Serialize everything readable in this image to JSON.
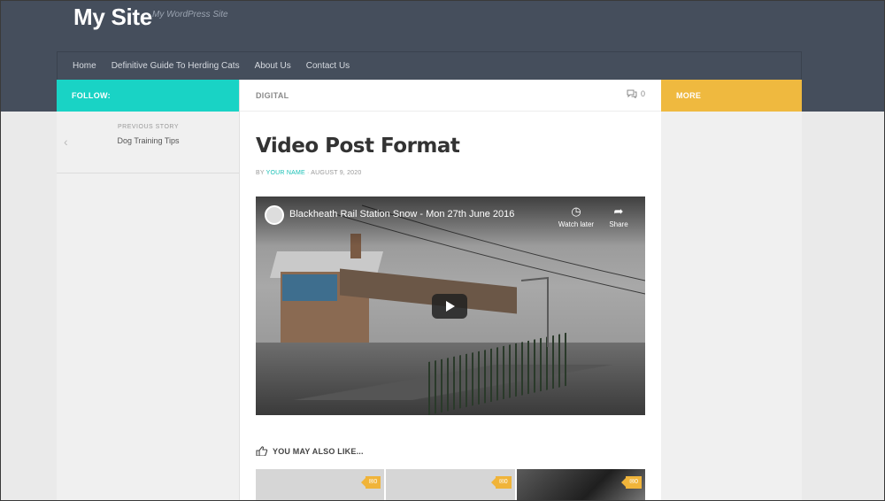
{
  "header": {
    "site_title": "My Site",
    "tagline": "My WordPress Site"
  },
  "nav": {
    "items": [
      {
        "label": "Home"
      },
      {
        "label": "Definitive Guide To Herding Cats"
      },
      {
        "label": "About Us"
      },
      {
        "label": "Contact Us"
      }
    ]
  },
  "left_sidebar": {
    "follow_label": "FOLLOW:",
    "previous_story_label": "PREVIOUS STORY",
    "previous_story_title": "Dog Training Tips"
  },
  "post": {
    "category": "DIGITAL",
    "comment_count": "0",
    "title": "Video Post Format",
    "meta_by": "BY",
    "author": "YOUR NAME",
    "date": "· AUGUST 9, 2020"
  },
  "video": {
    "title": "Blackheath Rail Station Snow - Mon 27th June 2016",
    "watch_later_label": "Watch later",
    "share_label": "Share"
  },
  "related": {
    "heading": "YOU MAY ALSO LIKE...",
    "items": [
      {
        "comments": "0"
      },
      {
        "comments": "0"
      },
      {
        "comments": "0"
      }
    ]
  },
  "right_sidebar": {
    "more_label": "MORE"
  },
  "colors": {
    "header_bg": "#454e5c",
    "follow_accent": "#19d3c5",
    "more_accent": "#efb93f",
    "author_link": "#19c0b6"
  }
}
